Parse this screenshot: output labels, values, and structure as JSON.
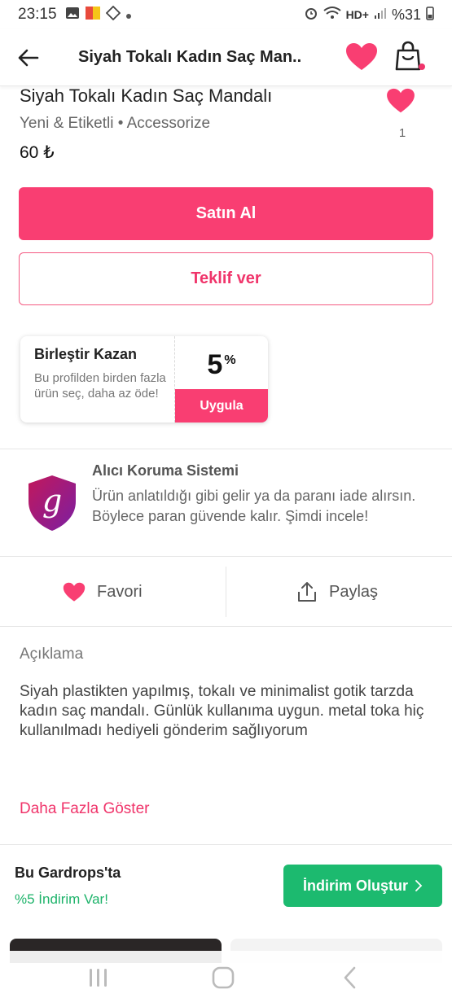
{
  "status_bar": {
    "time": "23:15",
    "battery": "%31",
    "network": "HD+"
  },
  "header": {
    "title": "Siyah Tokalı Kadın Saç Man.."
  },
  "product": {
    "title": "Siyah Tokalı Kadın Saç Mandalı",
    "subtitle": "Yeni & Etiketli • Accessorize",
    "price": "60 ₺",
    "like_count": "1"
  },
  "buttons": {
    "buy": "Satın Al",
    "offer": "Teklif ver"
  },
  "coupon": {
    "title": "Birleştir Kazan",
    "description": "Bu profilden birden fazla ürün seç, daha az öde!",
    "percent": "5",
    "percent_sign": "%",
    "apply": "Uygula"
  },
  "protection": {
    "title": "Alıcı Koruma Sistemi",
    "text": "Ürün anlatıldığı gibi gelir ya da paranı iade alırsın. Böylece paran güvende kalır. Şimdi incele!",
    "icon_letter": "g"
  },
  "actions": {
    "favorite": "Favori",
    "share": "Paylaş"
  },
  "description": {
    "heading": "Açıklama",
    "body": "Siyah plastikten yapılmış, tokalı ve minimalist gotik tarzda kadın saç mandalı. Günlük kullanıma uygun. metal toka hiç kullanılmadı hediyeli gönderim sağlıyorum",
    "show_more": "Daha Fazla Göster"
  },
  "promo": {
    "title": "Bu Gardrops'ta",
    "subtitle": "%5 İndirim Var!",
    "button": "İndirim Oluştur"
  },
  "colors": {
    "accent_pink": "#f93e72",
    "accent_green": "#1cba6f"
  }
}
